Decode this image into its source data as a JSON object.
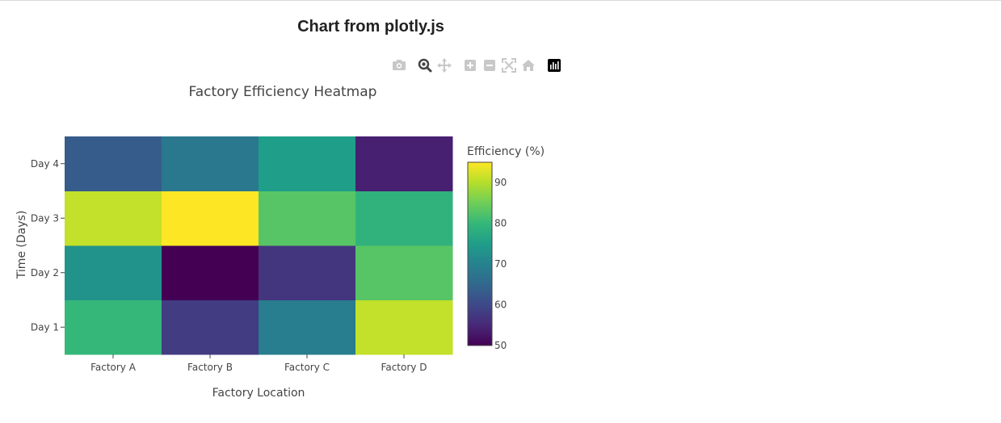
{
  "page": {
    "title": "Chart from plotly.js"
  },
  "modebar": {
    "buttons": [
      {
        "name": "camera-icon",
        "active": false
      },
      {
        "name": "zoom-icon",
        "active": true
      },
      {
        "name": "pan-icon",
        "active": false
      },
      {
        "name": "zoom-in-icon",
        "active": false
      },
      {
        "name": "zoom-out-icon",
        "active": false
      },
      {
        "name": "autoscale-icon",
        "active": false
      },
      {
        "name": "home-icon",
        "active": false
      },
      {
        "name": "plotly-logo-icon",
        "active": false
      }
    ]
  },
  "chart_data": {
    "type": "heatmap",
    "title": "Factory Efficiency Heatmap",
    "xlabel": "Factory Location",
    "ylabel": "Time (Days)",
    "x": [
      "Factory A",
      "Factory B",
      "Factory C",
      "Factory D"
    ],
    "y": [
      "Day 1",
      "Day 2",
      "Day 3",
      "Day 4"
    ],
    "z": [
      [
        80,
        58,
        69,
        91
      ],
      [
        73,
        50,
        57,
        83
      ],
      [
        91,
        95,
        83,
        79
      ],
      [
        63,
        68,
        75,
        54
      ]
    ],
    "colorscale": "Viridis",
    "colorbar": {
      "title": "Efficiency (%)",
      "range": [
        50,
        95
      ],
      "ticks": [
        50,
        60,
        70,
        80,
        90
      ]
    }
  }
}
